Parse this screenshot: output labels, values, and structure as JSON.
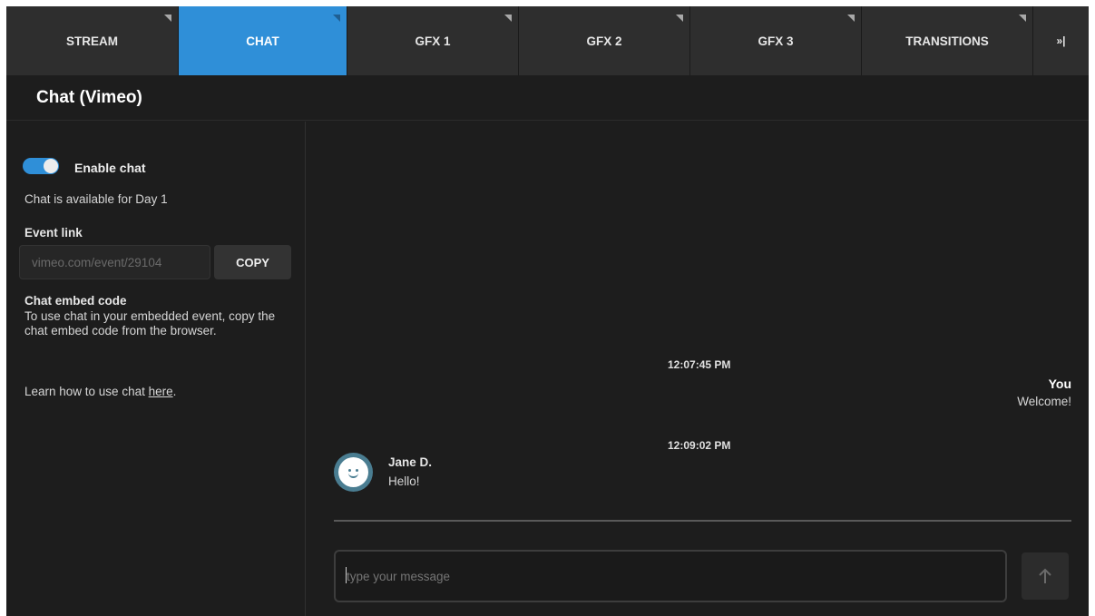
{
  "tabs": [
    {
      "label": "STREAM"
    },
    {
      "label": "CHAT"
    },
    {
      "label": "GFX 1"
    },
    {
      "label": "GFX 2"
    },
    {
      "label": "GFX 3"
    },
    {
      "label": "TRANSITIONS"
    },
    {
      "label": "»|"
    }
  ],
  "active_tab": "CHAT",
  "header": {
    "title": "Chat (Vimeo)"
  },
  "settings": {
    "enable_chat_label": "Enable chat",
    "enable_chat_on": true,
    "availability": "Chat is available for Day 1",
    "event_link_label": "Event link",
    "event_link_value": "vimeo.com/event/29104",
    "copy_label": "COPY",
    "embed_title": "Chat embed code",
    "embed_desc": "To use chat in your embedded event, copy the chat embed code from the browser.",
    "learn_prefix": "Learn how to use chat ",
    "learn_link": "here",
    "learn_suffix": "."
  },
  "chat": {
    "messages": [
      {
        "time": "12:07:45 PM",
        "author": "You",
        "text": "Welcome!"
      },
      {
        "time": "12:09:02 PM",
        "author": "Jane D.",
        "text": "Hello!"
      }
    ],
    "input_placeholder": "type your message",
    "send_icon": "arrow-up-icon"
  },
  "colors": {
    "accent": "#2f8fd8",
    "background": "#1d1d1d",
    "tab_bg": "#2e2e2e",
    "avatar": "#4a7d91"
  }
}
